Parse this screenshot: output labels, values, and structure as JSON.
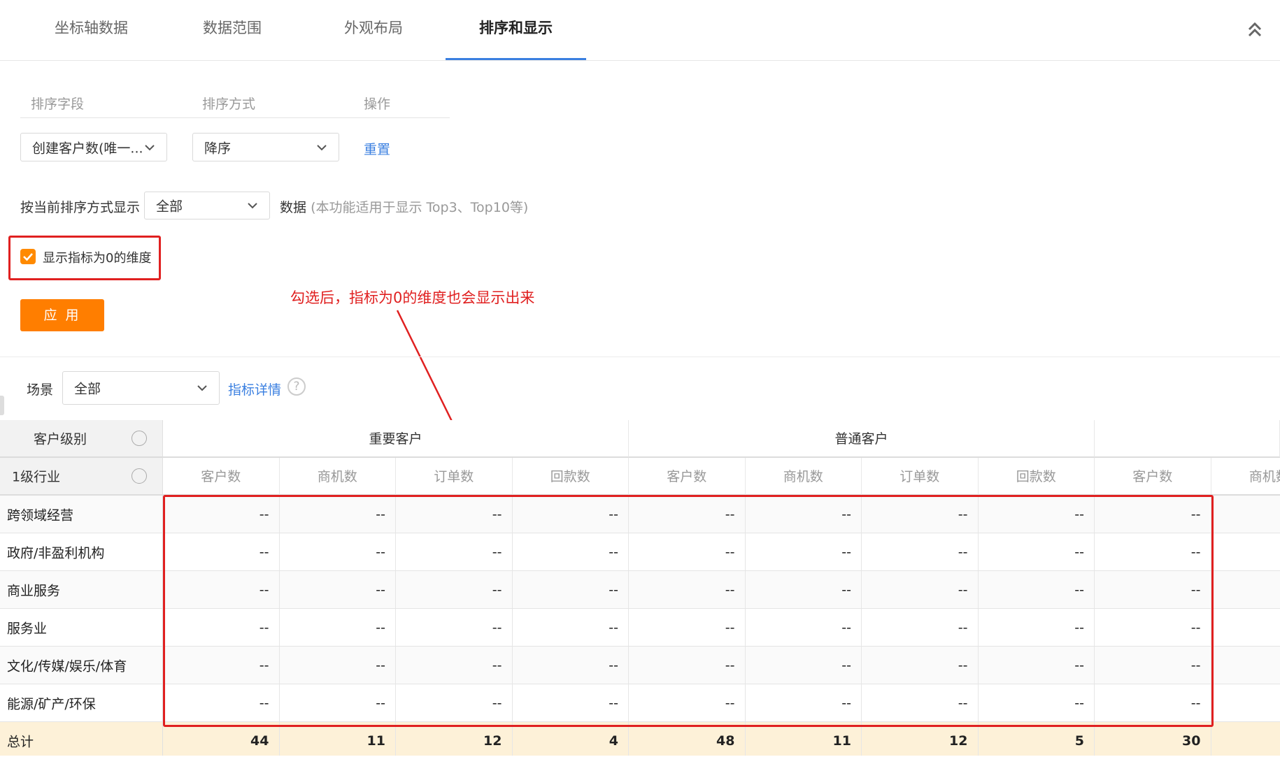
{
  "tabs": [
    {
      "label": "坐标轴数据"
    },
    {
      "label": "数据范围"
    },
    {
      "label": "外观布局"
    },
    {
      "label": "排序和显示"
    }
  ],
  "sort": {
    "headers": {
      "field": "排序字段",
      "method": "排序方式",
      "action": "操作"
    },
    "field_value": "创建客户数(唯一...",
    "method_value": "降序",
    "reset_label": "重置"
  },
  "display": {
    "prefix": "按当前排序方式显示",
    "select_value": "全部",
    "suffix": "数据",
    "hint": "(本功能适用于显示 Top3、Top10等)"
  },
  "show_zero": {
    "label": "显示指标为0的维度",
    "checked": true
  },
  "apply_label": "应 用",
  "annotation": "勾选后，指标为0的维度也会显示出来",
  "scene": {
    "label": "场景",
    "value": "全部",
    "detail_link": "指标详情",
    "help_glyph": "?"
  },
  "table": {
    "corner_top": "客户级别",
    "corner_bottom": "1级行业",
    "groups": [
      "重要客户",
      "普通客户"
    ],
    "columns": [
      "客户数",
      "商机数",
      "订单数",
      "回款数",
      "客户数",
      "商机数",
      "订单数",
      "回款数",
      "客户数",
      "商机数"
    ],
    "rows": [
      {
        "label": "跨领域经营",
        "values": [
          "--",
          "--",
          "--",
          "--",
          "--",
          "--",
          "--",
          "--",
          "--"
        ]
      },
      {
        "label": "政府/非盈利机构",
        "values": [
          "--",
          "--",
          "--",
          "--",
          "--",
          "--",
          "--",
          "--",
          "--"
        ]
      },
      {
        "label": "商业服务",
        "values": [
          "--",
          "--",
          "--",
          "--",
          "--",
          "--",
          "--",
          "--",
          "--"
        ]
      },
      {
        "label": "服务业",
        "values": [
          "--",
          "--",
          "--",
          "--",
          "--",
          "--",
          "--",
          "--",
          "--"
        ]
      },
      {
        "label": "文化/传媒/娱乐/体育",
        "values": [
          "--",
          "--",
          "--",
          "--",
          "--",
          "--",
          "--",
          "--",
          "--"
        ]
      },
      {
        "label": "能源/矿产/环保",
        "values": [
          "--",
          "--",
          "--",
          "--",
          "--",
          "--",
          "--",
          "--",
          "--"
        ]
      }
    ],
    "total": {
      "label": "总计",
      "values": [
        "44",
        "11",
        "12",
        "4",
        "48",
        "11",
        "12",
        "5",
        "30"
      ]
    }
  },
  "colors": {
    "accent": "#3a7fe0",
    "orange": "#ff7e00",
    "annotation_red": "#e02020",
    "total_bg": "#fdf1d8"
  }
}
